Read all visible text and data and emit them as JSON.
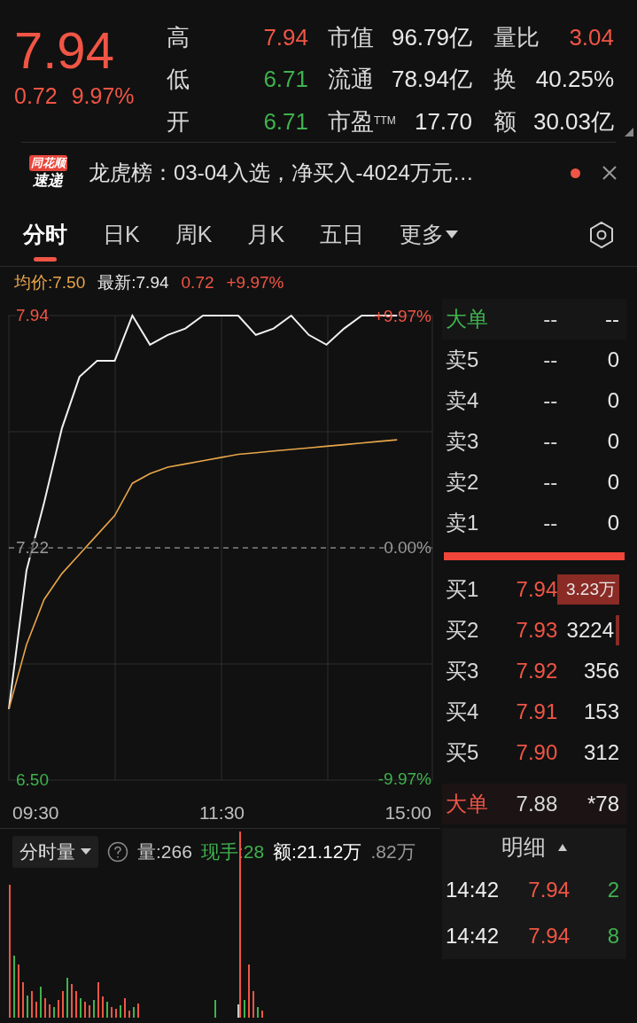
{
  "quote": {
    "price": "7.94",
    "change": "0.72",
    "change_pct": "9.97%"
  },
  "stats": [
    {
      "label": "高",
      "value": "7.94",
      "color": "#f05545"
    },
    {
      "label": "市值",
      "value": "96.79亿",
      "color": "#e8e8e8"
    },
    {
      "label": "量比",
      "value": "3.04",
      "color": "#f05545"
    },
    {
      "label": "低",
      "value": "6.71",
      "color": "#3fb24f"
    },
    {
      "label": "流通",
      "value": "78.94亿",
      "color": "#e8e8e8"
    },
    {
      "label": "换",
      "value": "40.25%",
      "color": "#e8e8e8"
    },
    {
      "label": "开",
      "value": "6.71",
      "color": "#3fb24f"
    },
    {
      "label": "市盈$^{TTM}$",
      "value": "17.70",
      "color": "#e8e8e8"
    },
    {
      "label": "额",
      "value": "30.03亿",
      "color": "#e8e8e8"
    }
  ],
  "news": {
    "badge_top": "同花顺",
    "badge_bottom": "速递",
    "text": "龙虎榜：03-04入选，净买入-4024万元…",
    "unread": true
  },
  "tabs": [
    {
      "label": "分时",
      "selected": true
    },
    {
      "label": "日K",
      "selected": false
    },
    {
      "label": "周K",
      "selected": false
    },
    {
      "label": "月K",
      "selected": false
    },
    {
      "label": "五日",
      "selected": false
    },
    {
      "label": "更多",
      "selected": false
    }
  ],
  "chart_header": {
    "avg": "均价:7.50",
    "latest": "最新:7.94",
    "change": "0.72",
    "change_pct": "+9.97%"
  },
  "price_chart": {
    "chart_data": {
      "type": "line",
      "categories": [
        null,
        null,
        null,
        null,
        null,
        null,
        null,
        null,
        null,
        null,
        null,
        null,
        null,
        null,
        null,
        null,
        null,
        null,
        null,
        null,
        null,
        null,
        null,
        null,
        null
      ],
      "grid": true,
      "ref_lines": [
        {
          "axis": "y",
          "value": 7.22
        }
      ],
      "series": [
        {
          "color": "#f0f0f0",
          "values": [
            6.72,
            7.15,
            7.36,
            7.59,
            7.75,
            7.8,
            7.8,
            7.94,
            7.85,
            7.88,
            7.9,
            7.94,
            7.94,
            7.94,
            7.88,
            7.9,
            7.94,
            7.88,
            7.85,
            7.9,
            7.94,
            7.94,
            7.94,
            null,
            null
          ]
        },
        {
          "color": "#e8a64a",
          "values": [
            6.72,
            6.92,
            7.06,
            7.14,
            7.2,
            7.26,
            7.32,
            7.42,
            7.45,
            7.47,
            7.48,
            7.49,
            7.5,
            7.51,
            7.515,
            7.52,
            7.525,
            7.53,
            7.535,
            7.54,
            7.545,
            7.55,
            7.555,
            null,
            null
          ]
        }
      ],
      "ylim": [
        6.5,
        7.94
      ],
      "yticks": [
        {
          "value": 7.94,
          "label": "7.94"
        },
        {
          "value": 7.22,
          "label": "7.22"
        },
        {
          "value": 6.5,
          "label": "6.50"
        }
      ]
    },
    "percent_labels": [
      "+9.97%",
      "0.00%",
      "-9.97%"
    ],
    "time_labels": [
      "09:30",
      "11:30",
      "15:00"
    ]
  },
  "order_book": {
    "big_top": {
      "label": "大单",
      "price": "--",
      "volume": "--"
    },
    "asks": [
      {
        "label": "卖5",
        "price": "--",
        "volume": "0"
      },
      {
        "label": "卖4",
        "price": "--",
        "volume": "0"
      },
      {
        "label": "卖3",
        "price": "--",
        "volume": "0"
      },
      {
        "label": "卖2",
        "price": "--",
        "volume": "0"
      },
      {
        "label": "卖1",
        "price": "--",
        "volume": "0"
      }
    ],
    "bids": [
      {
        "label": "买1",
        "price": "7.94",
        "volume": "3.23万"
      },
      {
        "label": "买2",
        "price": "7.93",
        "volume": "3224"
      },
      {
        "label": "买3",
        "price": "7.92",
        "volume": "356"
      },
      {
        "label": "买4",
        "price": "7.91",
        "volume": "153"
      },
      {
        "label": "买5",
        "price": "7.90",
        "volume": "312"
      }
    ],
    "big_bottom": {
      "label": "大单",
      "price": "7.88",
      "volume": "*78"
    }
  },
  "volume_panel": {
    "selector": "分时量",
    "volume": "量:266",
    "hand": "现手:28",
    "amount": "额:21.12万",
    "hidden_amount": ".82万"
  },
  "details": {
    "title": "明细",
    "rows": [
      {
        "time": "14:42",
        "price": "7.94",
        "volume": "2"
      },
      {
        "time": "14:42",
        "price": "7.94",
        "volume": "8"
      }
    ]
  }
}
